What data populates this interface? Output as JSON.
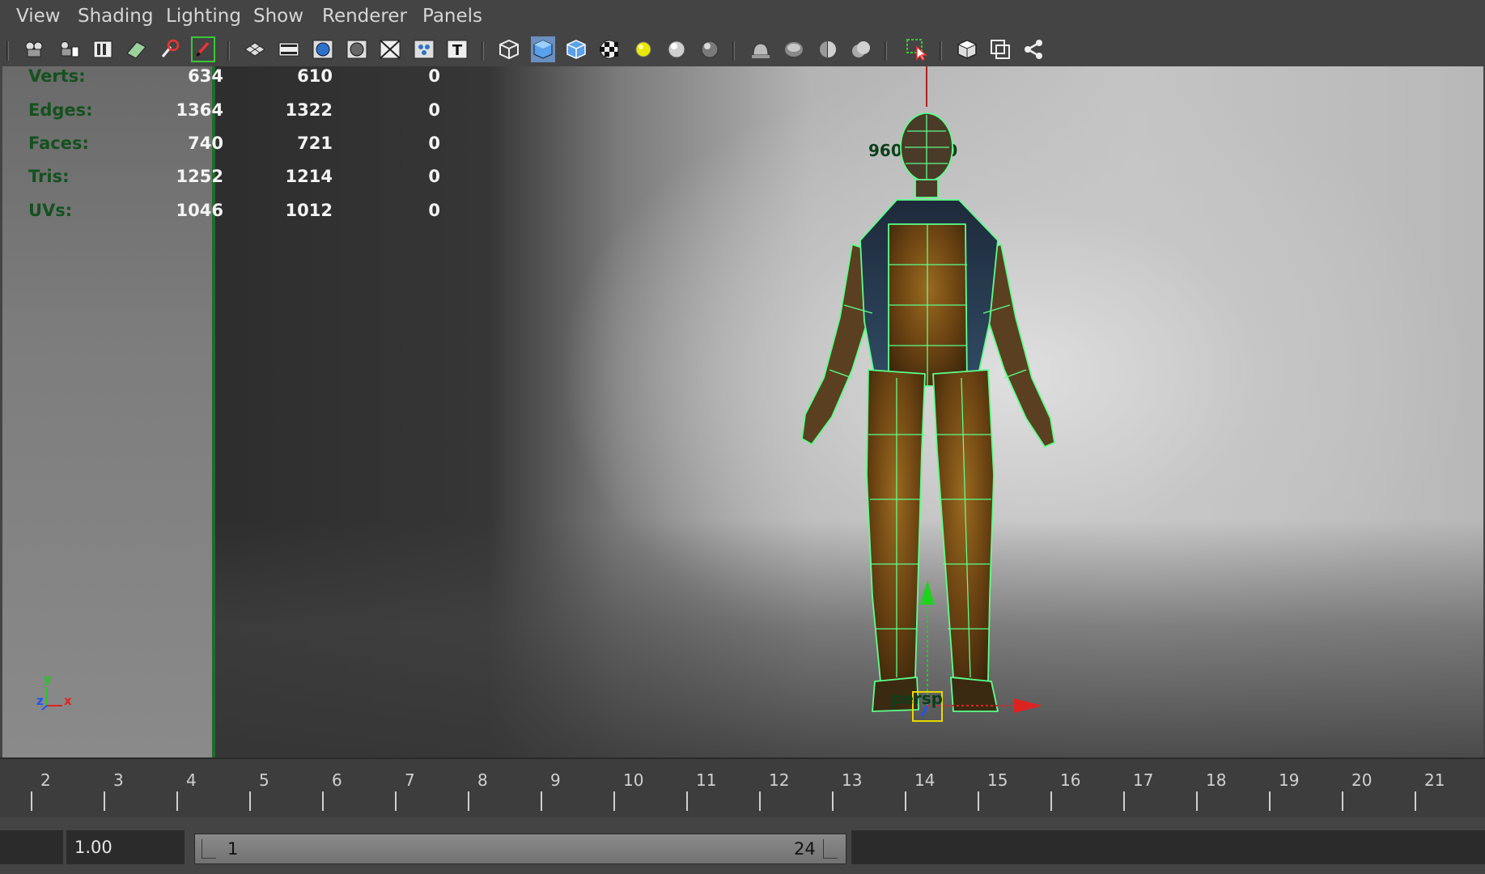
{
  "menu": {
    "items": [
      "View",
      "Shading",
      "Lighting",
      "Show",
      "Renderer",
      "Panels"
    ]
  },
  "toolbar": {
    "icons": [
      "camera-select-icon",
      "camera-attributes-icon",
      "bookmarks-icon",
      "image-plane-icon",
      "2d-pan-zoom-icon",
      "grease-pencil-icon",
      "grid-icon",
      "film-gate-icon",
      "resolution-gate-icon",
      "gate-mask-icon",
      "field-chart-icon",
      "safe-action-icon",
      "safe-title-icon",
      "wireframe-icon",
      "smooth-shade-icon",
      "wireframe-on-shaded-icon",
      "textured-icon",
      "use-all-lights-icon",
      "shadows-icon",
      "screen-space-ao-icon",
      "motion-blur-icon",
      "multisample-aa-icon",
      "depth-of-field-icon",
      "hardware-fog-icon",
      "isolate-select-icon",
      "xray-icon",
      "xray-active-components-icon",
      "xray-joints-icon"
    ],
    "accent": "#e8e800"
  },
  "hud": {
    "rows": [
      {
        "label": "Verts:",
        "col1": "634",
        "col2": "610",
        "col3": "0"
      },
      {
        "label": "Edges:",
        "col1": "1364",
        "col2": "1322",
        "col3": "0"
      },
      {
        "label": "Faces:",
        "col1": "740",
        "col2": "721",
        "col3": "0"
      },
      {
        "label": "Tris:",
        "col1": "1252",
        "col2": "1214",
        "col3": "0"
      },
      {
        "label": "UVs:",
        "col1": "1046",
        "col2": "1012",
        "col3": "0"
      }
    ],
    "label_color": "#14511f",
    "resolution": "960 x 540",
    "camera_name": "persp",
    "axes": {
      "y": "y",
      "z": "z",
      "x": "x"
    }
  },
  "model": {
    "wire_color": "#5cff8a"
  },
  "timeslider": {
    "ticks": [
      "2",
      "3",
      "4",
      "5",
      "6",
      "7",
      "8",
      "9",
      "10",
      "11",
      "12",
      "13",
      "14",
      "15",
      "16",
      "17",
      "18",
      "19",
      "20",
      "21"
    ]
  },
  "rangeslider": {
    "playback_start": "1.00",
    "range_start": "1",
    "range_end": "24"
  }
}
